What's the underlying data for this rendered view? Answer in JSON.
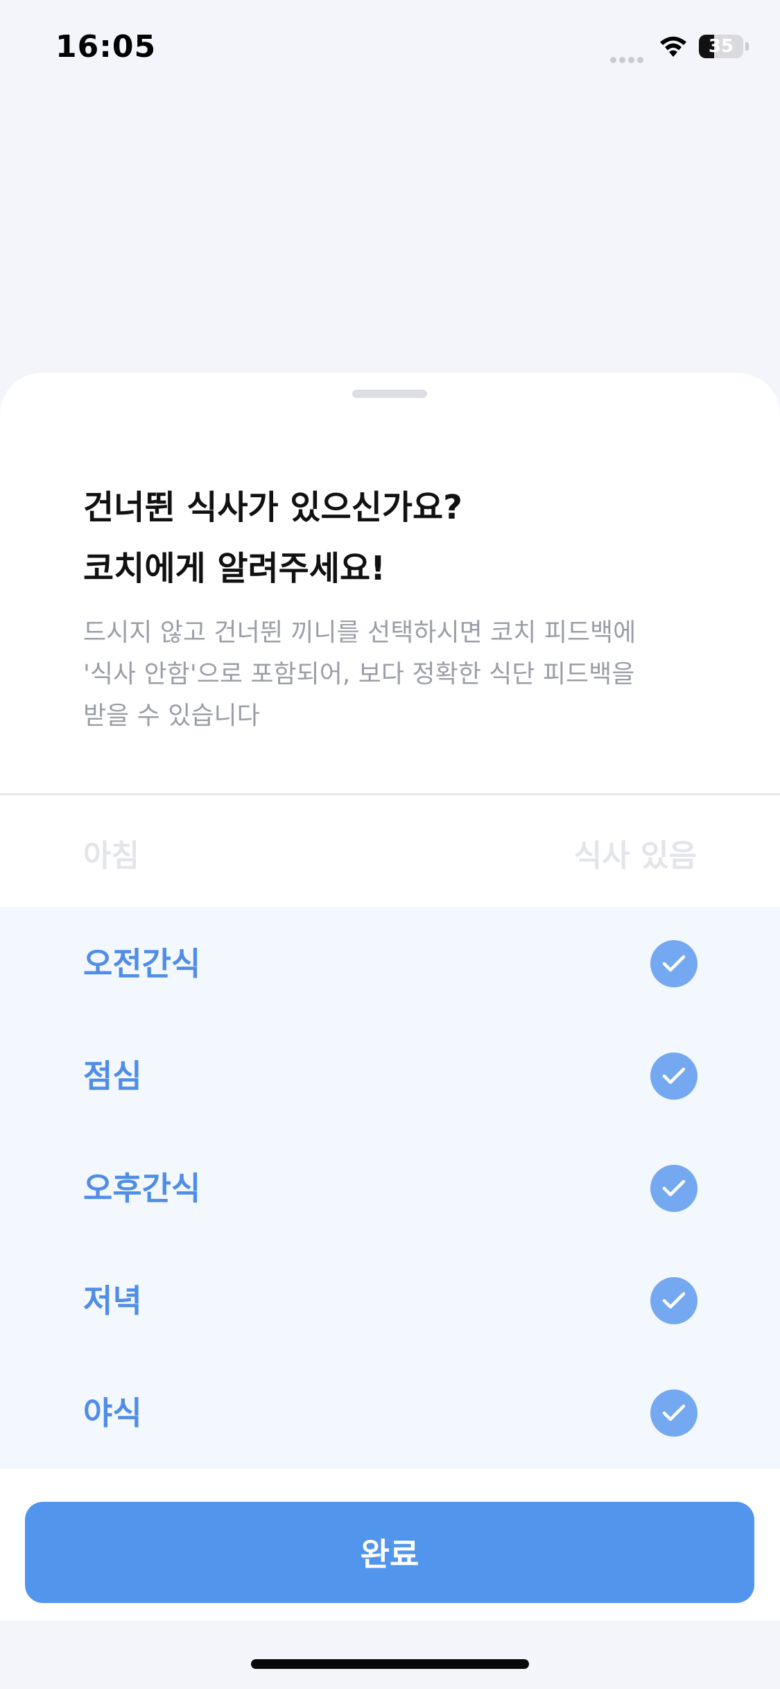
{
  "status_bar": {
    "time": "16:05",
    "battery_level": "35",
    "battery_fraction": 0.35,
    "wifi_icon": "wifi-icon",
    "battery_icon": "battery-icon"
  },
  "sheet": {
    "title_lines": [
      "건너뛴 식사가 있으신가요?",
      "코치에게 알려주세요!"
    ],
    "description_lines": [
      "드시지 않고 건너뛴 끼니를 선택하시면 코치 피드백에",
      "'식사 안함'으로 포함되어, 보다 정확한 식단 피드백을",
      "받을 수 있습니다"
    ],
    "faded_row": {
      "label": "아침",
      "status": "식사 있음"
    },
    "meals": [
      {
        "label": "오전간식",
        "checked": true,
        "icon": "check-circle-icon"
      },
      {
        "label": "점심",
        "checked": true,
        "icon": "check-circle-icon"
      },
      {
        "label": "오후간식",
        "checked": true,
        "icon": "check-circle-icon"
      },
      {
        "label": "저녁",
        "checked": true,
        "icon": "check-circle-icon"
      },
      {
        "label": "야식",
        "checked": true,
        "icon": "check-circle-icon"
      }
    ],
    "done_label": "완료"
  },
  "colors": {
    "accent": "#5295EC",
    "meal_label": "#4F8DE6",
    "check_circle": "#74A8F0",
    "list_background": "#F3F7FE",
    "screen_background": "#F3F5FB"
  }
}
